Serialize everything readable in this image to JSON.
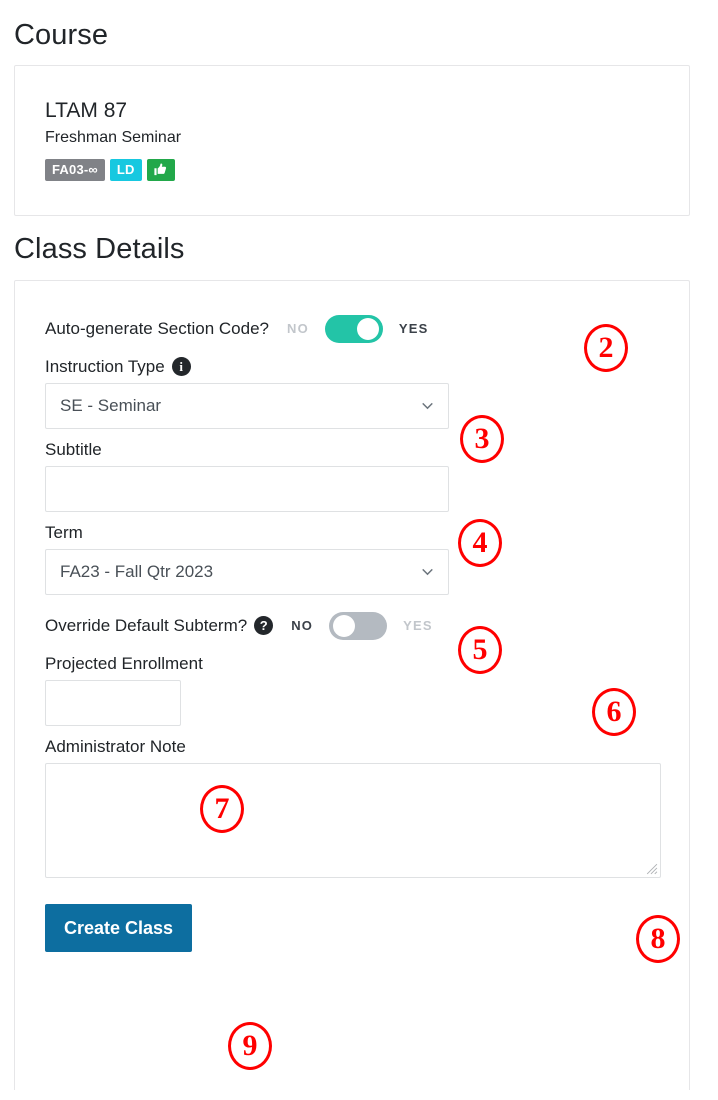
{
  "page": {
    "course_heading": "Course",
    "details_heading": "Class Details"
  },
  "course_card": {
    "code": "LTAM 87",
    "title": "Freshman Seminar",
    "badges": [
      {
        "label": "FA03-∞",
        "type": "text",
        "color": "#808287",
        "icon": ""
      },
      {
        "label": "LD",
        "type": "text",
        "color": "#17c8e0",
        "icon": ""
      },
      {
        "label": "",
        "type": "icon",
        "color": "#22a84a",
        "icon": "thumbs-up-icon"
      }
    ]
  },
  "class_details": {
    "auto_generate": {
      "label": "Auto-generate Section Code?",
      "no_label": "NO",
      "yes_label": "YES",
      "state": "on"
    },
    "instruction_type": {
      "label": "Instruction Type",
      "hint_icon": "info-icon",
      "value": "SE - Seminar",
      "chevron": "chevron-down-icon"
    },
    "subtitle": {
      "label": "Subtitle",
      "value": "",
      "placeholder": ""
    },
    "term": {
      "label": "Term",
      "value": "FA23 - Fall Qtr 2023",
      "chevron": "chevron-down-icon"
    },
    "override_subterm": {
      "label": "Override Default Subterm?",
      "hint_icon": "help-icon",
      "no_label": "NO",
      "yes_label": "YES",
      "state": "off"
    },
    "projected_enrollment": {
      "label": "Projected Enrollment",
      "value": "",
      "placeholder": ""
    },
    "administrator_note": {
      "label": "Administrator Note",
      "value": "",
      "placeholder": ""
    },
    "submit_button": "Create Class"
  },
  "markers": {
    "m2": "2",
    "m3": "3",
    "m4": "4",
    "m5": "5",
    "m6": "6",
    "m7": "7",
    "m8": "8",
    "m9": "9"
  },
  "colors": {
    "toggle_on": "#23c4a7",
    "toggle_off": "#b4bac1",
    "primary_button": "#0d6ea0",
    "marker": "#ff0000",
    "badge_gray": "#808287",
    "badge_cyan": "#17c8e0",
    "badge_green": "#22a84a"
  }
}
